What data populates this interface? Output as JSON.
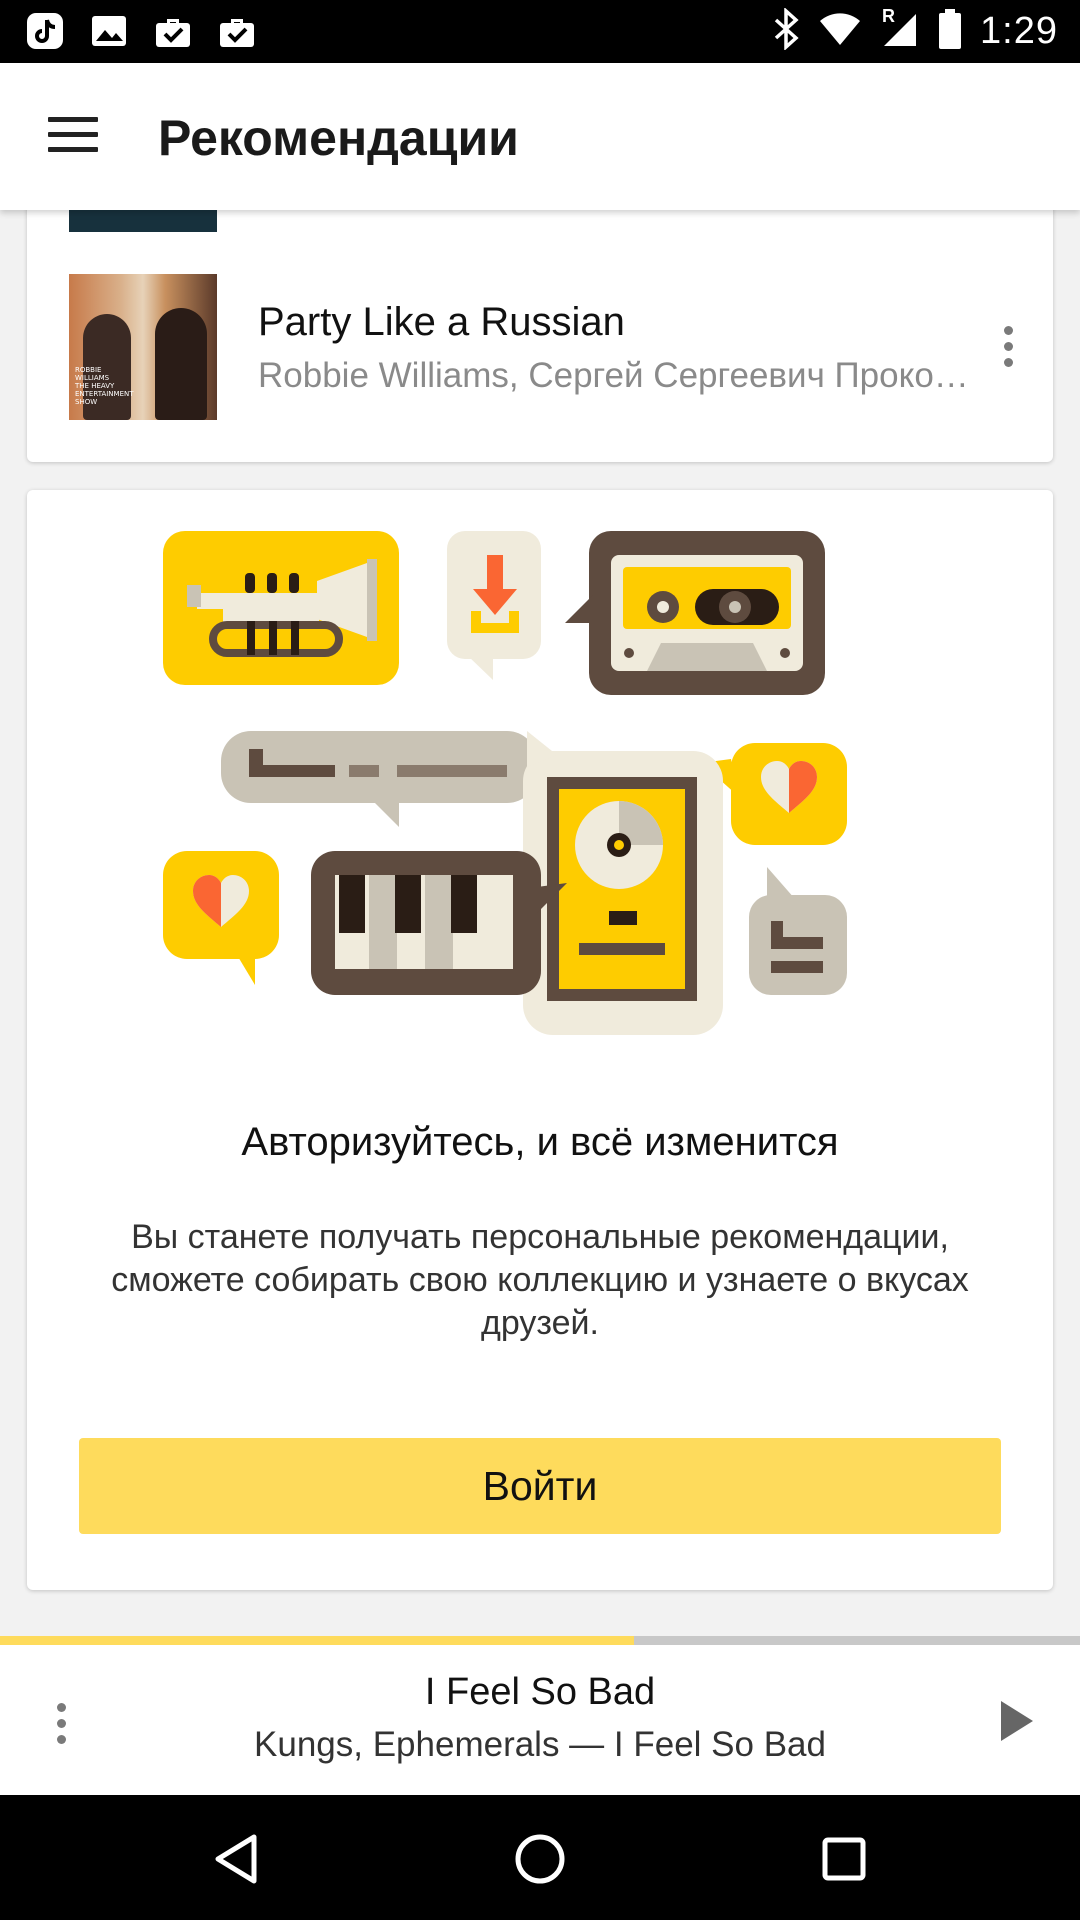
{
  "status_bar": {
    "time": "1:29",
    "left_icons": [
      "tiktok-icon",
      "image-icon",
      "briefcase-check-icon",
      "briefcase-check-icon"
    ],
    "right_icons": [
      "bluetooth-icon",
      "wifi-icon",
      "signal-icon",
      "battery-icon"
    ],
    "roaming": "R"
  },
  "app_bar": {
    "menu_icon": "hamburger-icon",
    "title": "Рекомендации"
  },
  "track": {
    "title": "Party Like a Russian",
    "subtitle": "Robbie Williams, Сергей Сергеевич Прокофьев",
    "more_icon": "more-vert-icon",
    "cover_text": [
      "ROBBIE",
      "WILLIAMS",
      "THE HEAVY",
      "ENTERTAINMENT",
      "SHOW"
    ]
  },
  "promo": {
    "heading": "Авторизуйтесь, и всё изменится",
    "text": "Вы станете получать персональные рекомендации, сможете собирать свою коллекцию и узнаете о вкусах друзей.",
    "button_label": "Войти",
    "colors": {
      "yellow": "#fecc00",
      "brown": "#5e4b3f",
      "cream": "#f0ebdc",
      "gray": "#c9c3b5",
      "orange": "#fa6633"
    }
  },
  "player": {
    "title": "I Feel So Bad",
    "subtitle": "Kungs, Ephemerals — I Feel So Bad",
    "progress": 0.587,
    "more_icon": "more-vert-icon",
    "play_icon": "play-icon"
  },
  "nav_bar": {
    "icons": [
      "back-icon",
      "home-icon",
      "recents-icon"
    ]
  },
  "colors": {
    "accent": "#fedb5c",
    "progress_track": "#c8c8c8",
    "subtitle_gray": "#8a8a8a"
  }
}
